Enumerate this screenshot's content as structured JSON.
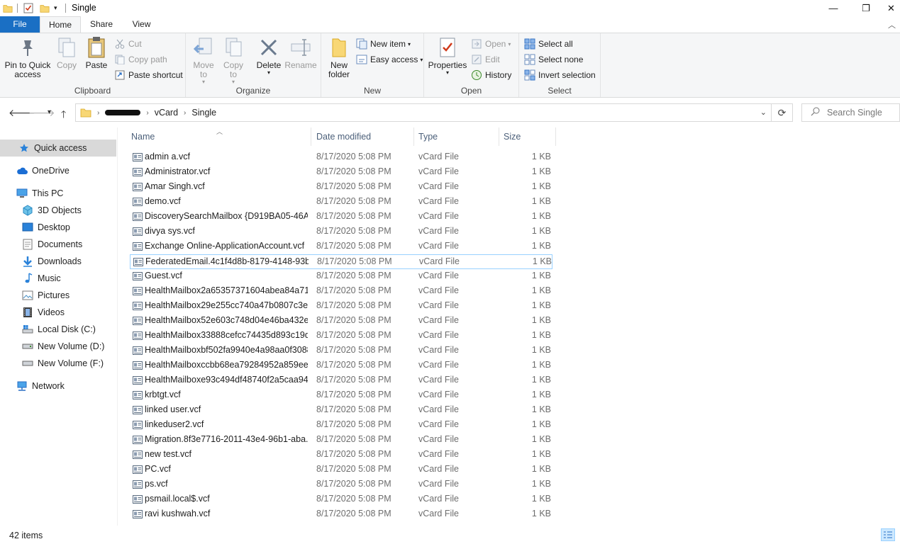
{
  "window": {
    "title": "Single",
    "minimize": "—",
    "restore": "❐",
    "close": "✕"
  },
  "tabs": {
    "file": "File",
    "home": "Home",
    "share": "Share",
    "view": "View"
  },
  "ribbon": {
    "clipboard": {
      "label": "Clipboard",
      "pin_line1": "Pin to Quick",
      "pin_line2": "access",
      "copy": "Copy",
      "paste": "Paste",
      "cut": "Cut",
      "copy_path": "Copy path",
      "paste_shortcut": "Paste shortcut"
    },
    "organize": {
      "label": "Organize",
      "move_line1": "Move",
      "move_line2": "to",
      "copy_line1": "Copy",
      "copy_line2": "to",
      "delete": "Delete",
      "rename": "Rename"
    },
    "new": {
      "label": "New",
      "folder_line1": "New",
      "folder_line2": "folder",
      "new_item": "New item",
      "easy_access": "Easy access"
    },
    "open": {
      "label": "Open",
      "properties": "Properties",
      "open": "Open",
      "edit": "Edit",
      "history": "History"
    },
    "select": {
      "label": "Select",
      "select_all": "Select all",
      "select_none": "Select none",
      "invert": "Invert selection"
    }
  },
  "address": {
    "crumbs": [
      "vCard",
      "Single"
    ],
    "search_placeholder": "Search Single"
  },
  "nav": {
    "quick_access": "Quick access",
    "onedrive": "OneDrive",
    "this_pc": "This PC",
    "objects3d": "3D Objects",
    "desktop": "Desktop",
    "documents": "Documents",
    "downloads": "Downloads",
    "music": "Music",
    "pictures": "Pictures",
    "videos": "Videos",
    "local_disk": "Local Disk (C:)",
    "new_volume_d": "New Volume (D:)",
    "new_volume_f": "New Volume (F:)",
    "network": "Network"
  },
  "columns": {
    "name": "Name",
    "date": "Date modified",
    "type": "Type",
    "size": "Size"
  },
  "files": [
    {
      "name": "admin a.vcf",
      "date": "8/17/2020 5:08 PM",
      "type": "vCard File",
      "size": "1 KB"
    },
    {
      "name": "Administrator.vcf",
      "date": "8/17/2020 5:08 PM",
      "type": "vCard File",
      "size": "1 KB"
    },
    {
      "name": "Amar Singh.vcf",
      "date": "8/17/2020 5:08 PM",
      "type": "vCard File",
      "size": "1 KB"
    },
    {
      "name": "demo.vcf",
      "date": "8/17/2020 5:08 PM",
      "type": "vCard File",
      "size": "1 KB"
    },
    {
      "name": "DiscoverySearchMailbox {D919BA05-46A...",
      "date": "8/17/2020 5:08 PM",
      "type": "vCard File",
      "size": "1 KB"
    },
    {
      "name": "divya sys.vcf",
      "date": "8/17/2020 5:08 PM",
      "type": "vCard File",
      "size": "1 KB"
    },
    {
      "name": "Exchange Online-ApplicationAccount.vcf",
      "date": "8/17/2020 5:08 PM",
      "type": "vCard File",
      "size": "1 KB"
    },
    {
      "name": "FederatedEmail.4c1f4d8b-8179-4148-93b...",
      "date": "8/17/2020 5:08 PM",
      "type": "vCard File",
      "size": "1 KB"
    },
    {
      "name": "Guest.vcf",
      "date": "8/17/2020 5:08 PM",
      "type": "vCard File",
      "size": "1 KB"
    },
    {
      "name": "HealthMailbox2a65357371604abea84a715...",
      "date": "8/17/2020 5:08 PM",
      "type": "vCard File",
      "size": "1 KB"
    },
    {
      "name": "HealthMailbox29e255cc740a47b0807c3e...",
      "date": "8/17/2020 5:08 PM",
      "type": "vCard File",
      "size": "1 KB"
    },
    {
      "name": "HealthMailbox52e603c748d04e46ba432e...",
      "date": "8/17/2020 5:08 PM",
      "type": "vCard File",
      "size": "1 KB"
    },
    {
      "name": "HealthMailbox33888cefcc74435d893c19d...",
      "date": "8/17/2020 5:08 PM",
      "type": "vCard File",
      "size": "1 KB"
    },
    {
      "name": "HealthMailboxbf502fa9940e4a98aa0f3088...",
      "date": "8/17/2020 5:08 PM",
      "type": "vCard File",
      "size": "1 KB"
    },
    {
      "name": "HealthMailboxccbb68ea79284952a859ee...",
      "date": "8/17/2020 5:08 PM",
      "type": "vCard File",
      "size": "1 KB"
    },
    {
      "name": "HealthMailboxe93c494df48740f2a5caa94...",
      "date": "8/17/2020 5:08 PM",
      "type": "vCard File",
      "size": "1 KB"
    },
    {
      "name": "krbtgt.vcf",
      "date": "8/17/2020 5:08 PM",
      "type": "vCard File",
      "size": "1 KB"
    },
    {
      "name": "linked user.vcf",
      "date": "8/17/2020 5:08 PM",
      "type": "vCard File",
      "size": "1 KB"
    },
    {
      "name": "linkeduser2.vcf",
      "date": "8/17/2020 5:08 PM",
      "type": "vCard File",
      "size": "1 KB"
    },
    {
      "name": "Migration.8f3e7716-2011-43e4-96b1-aba...",
      "date": "8/17/2020 5:08 PM",
      "type": "vCard File",
      "size": "1 KB"
    },
    {
      "name": "new test.vcf",
      "date": "8/17/2020 5:08 PM",
      "type": "vCard File",
      "size": "1 KB"
    },
    {
      "name": "PC.vcf",
      "date": "8/17/2020 5:08 PM",
      "type": "vCard File",
      "size": "1 KB"
    },
    {
      "name": "ps.vcf",
      "date": "8/17/2020 5:08 PM",
      "type": "vCard File",
      "size": "1 KB"
    },
    {
      "name": "psmail.local$.vcf",
      "date": "8/17/2020 5:08 PM",
      "type": "vCard File",
      "size": "1 KB"
    },
    {
      "name": "ravi kushwah.vcf",
      "date": "8/17/2020 5:08 PM",
      "type": "vCard File",
      "size": "1 KB"
    }
  ],
  "status": {
    "count": "42 items"
  },
  "colors": {
    "file_tab": "#1a6fc4",
    "selection": "#d9d9d9",
    "focus_border": "#99d1ff"
  }
}
